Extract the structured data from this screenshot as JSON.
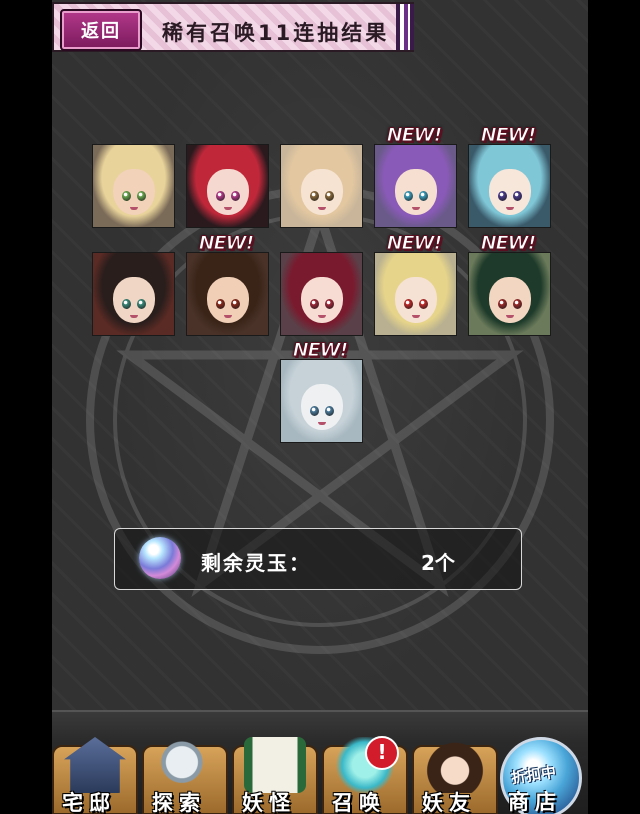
{
  "header": {
    "back_label": "返回",
    "title": "稀有召唤11连抽结果"
  },
  "results": [
    {
      "name": "card-1",
      "new": false,
      "hair": "#e8d39a",
      "skin": "#f2d2b8",
      "eye": "#6aa84f",
      "bg": "#7a6a58"
    },
    {
      "name": "card-2",
      "new": false,
      "hair": "#c0283a",
      "skin": "#f5d9d0",
      "eye": "#b43a8a",
      "bg": "#2a1a1e"
    },
    {
      "name": "card-3",
      "new": false,
      "hair": "#e2c7a0",
      "skin": "#f6e3d2",
      "eye": "#8a6a3a",
      "bg": "#c8b59a"
    },
    {
      "name": "card-4",
      "new": true,
      "hair": "#8a5ab8",
      "skin": "#f6dfd0",
      "eye": "#3a9ab8",
      "bg": "#6a5a8a"
    },
    {
      "name": "card-5",
      "new": true,
      "hair": "#7fc6d6",
      "skin": "#f7e6da",
      "eye": "#4a3a8a",
      "bg": "#3a5a6a"
    },
    {
      "name": "card-6",
      "new": false,
      "hair": "#2a1e1c",
      "skin": "#f0d6c4",
      "eye": "#3a8a7a",
      "bg": "#5a2a24"
    },
    {
      "name": "card-7",
      "new": true,
      "hair": "#3a2418",
      "skin": "#f0cfb6",
      "eye": "#8a2a1a",
      "bg": "#4a3228"
    },
    {
      "name": "card-8",
      "new": false,
      "hair": "#7a1a2e",
      "skin": "#f6dcd2",
      "eye": "#a0283a",
      "bg": "#5a4048"
    },
    {
      "name": "card-9",
      "new": true,
      "hair": "#e6d48a",
      "skin": "#f6e2d4",
      "eye": "#c02a2a",
      "bg": "#b8b090"
    },
    {
      "name": "card-10",
      "new": true,
      "hair": "#1e3a2a",
      "skin": "#f2d6c2",
      "eye": "#9a2a2a",
      "bg": "#6a7a5a"
    },
    {
      "name": "card-11",
      "new": true,
      "hair": "#c6d2d8",
      "skin": "#eef0f2",
      "eye": "#4a7a9a",
      "bg": "#a8b8c0"
    }
  ],
  "new_badge_text": "NEW!",
  "jade": {
    "label": "剩余灵玉：",
    "count": "2个"
  },
  "nav": {
    "items": [
      {
        "name": "nav-home",
        "label": "宅邸",
        "icon": "mansion-icon"
      },
      {
        "name": "nav-explore",
        "label": "探索",
        "icon": "magnifier-icon"
      },
      {
        "name": "nav-yokai",
        "label": "妖怪",
        "icon": "scroll-icon"
      },
      {
        "name": "nav-summon",
        "label": "召唤",
        "icon": "pentacle-icon"
      },
      {
        "name": "nav-shiki",
        "label": "妖友",
        "icon": "catgirl-icon"
      }
    ],
    "summon_alert": "!",
    "shop_label": "商店",
    "shop_badge": "折扣中"
  },
  "colors": {
    "background": "#323232",
    "header_pink": "#f3d9e8",
    "back_button": "#9a2a78",
    "nav_gold": "#c8913f",
    "alert_red": "#d21c2c"
  }
}
